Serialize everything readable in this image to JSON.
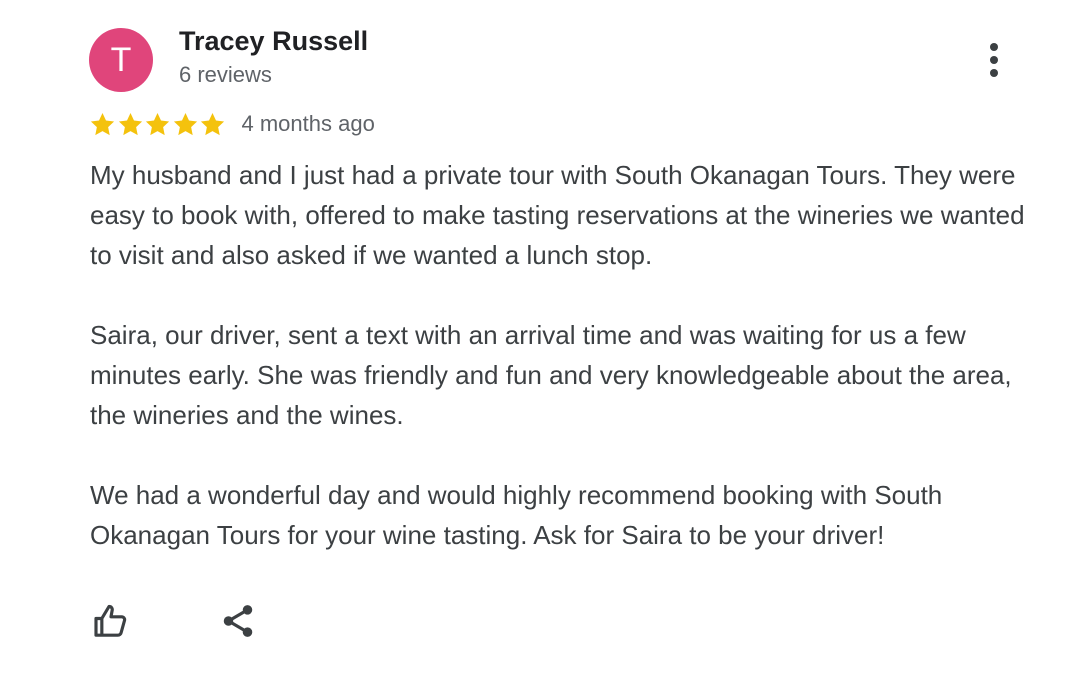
{
  "review": {
    "author": {
      "initial": "T",
      "name": "Tracey Russell",
      "review_count": "6 reviews",
      "avatar_color": "#e0457b"
    },
    "rating": 5,
    "rating_max": 5,
    "star_color": "#f4c20d",
    "date": "4 months ago",
    "paragraphs": [
      "My husband and I just had a private tour with South Okanagan Tours. They were easy to book with, offered to make tasting reservations at the wineries we wanted to visit and also asked if we wanted a lunch stop.",
      "Saira, our driver, sent a text with an arrival time and was waiting for us a few minutes early. She was friendly and fun and very knowledgeable about the area, the wineries and the wines.",
      "We had a wonderful day and would highly recommend booking with South Okanagan Tours for your wine tasting. Ask for Saira to be your driver!"
    ],
    "icons": {
      "more": "more-vert-icon",
      "like": "thumb-up-icon",
      "share": "share-icon"
    }
  }
}
